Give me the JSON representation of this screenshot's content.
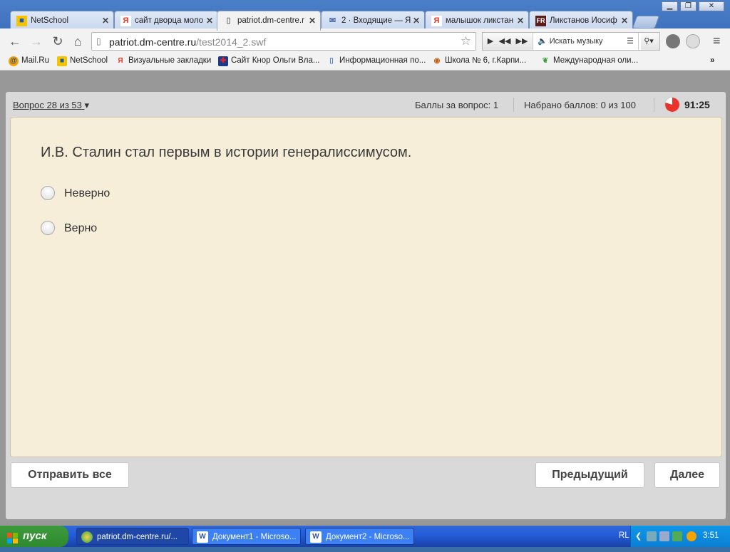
{
  "browser": {
    "tabs": [
      {
        "label": "NetSchool",
        "icon": "netschool-icon"
      },
      {
        "label": "сайт дворца моло",
        "icon": "yandex-icon"
      },
      {
        "label": "patriot.dm-centre.r",
        "icon": "page-icon"
      },
      {
        "label": "2 · Входящие — Я",
        "icon": "mail-icon"
      },
      {
        "label": "малышок ликстан",
        "icon": "yandex-icon"
      },
      {
        "label": "Ликстанов Иосиф",
        "icon": "fr-icon"
      }
    ],
    "url_host": "patriot.dm-centre.ru",
    "url_path": "/test2014_2.swf",
    "music_search": "Искать музыку",
    "bookmarks": [
      {
        "label": "Mail.Ru"
      },
      {
        "label": "NetSchool"
      },
      {
        "label": "Визуальные закладки"
      },
      {
        "label": "Сайт Кнор Ольги Вла..."
      },
      {
        "label": "Информационная по..."
      },
      {
        "label": "Школа № 6, г.Карпи..."
      },
      {
        "label": "Международная оли..."
      }
    ],
    "more_bookmarks": "»"
  },
  "quiz": {
    "question_nav": "Вопрос 28 из 53",
    "points_per_question": "Баллы за вопрос: 1",
    "total_points": "Набрано баллов: 0 из 100",
    "timer": "91:25",
    "question_text": "И.В. Сталин стал первым в истории генералиссимусом.",
    "options": [
      {
        "label": "Неверно",
        "selected": false
      },
      {
        "label": "Верно",
        "selected": false
      }
    ],
    "submit_all_label": "Отправить все",
    "previous_label": "Предыдущий",
    "next_label": "Далее"
  },
  "taskbar": {
    "start_label": "пуск",
    "tasks": [
      {
        "label": "patriot.dm-centre.ru/..."
      },
      {
        "label": "Документ1 - Microso..."
      },
      {
        "label": "Документ2 - Microso..."
      }
    ],
    "language": "RL",
    "clock": "3:51"
  },
  "colors": {
    "card_background": "#f7eed9",
    "timer_red": "#e8322a",
    "taskbar_blue": "#245edb",
    "start_green": "#2f8a2f"
  }
}
